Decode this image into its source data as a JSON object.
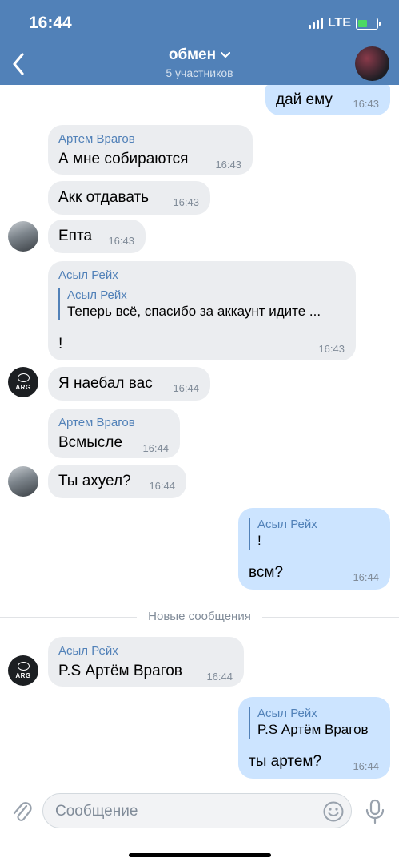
{
  "status_bar": {
    "time": "16:44",
    "network": "LTE"
  },
  "header": {
    "title": "обмен",
    "subtitle": "5 участников"
  },
  "messages": [
    {
      "text": "дай ему",
      "time": "16:43"
    },
    {
      "sender": "Артем Врагов",
      "text": "А мне собираются",
      "time": "16:43"
    },
    {
      "text": "Акк отдавать",
      "time": "16:43"
    },
    {
      "text": "Епта",
      "time": "16:43"
    },
    {
      "sender": "Асыл Рейх",
      "reply_name": "Асыл Рейх",
      "reply_text": "Теперь всё, спасибо за аккаунт идите ...",
      "text": "!",
      "time": "16:43"
    },
    {
      "text": "Я наебал вас",
      "time": "16:44"
    },
    {
      "sender": "Артем Врагов",
      "text": "Всмысле",
      "time": "16:44"
    },
    {
      "text": "Ты ахуел?",
      "time": "16:44"
    },
    {
      "reply_name": "Асыл Рейх",
      "reply_text": "!",
      "text": "всм?",
      "time": "16:44"
    },
    {
      "sender": "Асыл Рейх",
      "text": "P.S Артём Врагов",
      "time": "16:44"
    },
    {
      "reply_name": "Асыл Рейх",
      "reply_text": "P.S Артём Врагов",
      "text": "ты артем?",
      "time": "16:44"
    }
  ],
  "avatar_logo_text": "ARG",
  "new_messages_label": "Новые сообщения",
  "composer": {
    "placeholder": "Сообщение"
  },
  "colors": {
    "header": "#5181b8",
    "incoming_bubble": "#ebedf0",
    "outgoing_bubble": "#cce4ff",
    "accent": "#5181b8"
  }
}
